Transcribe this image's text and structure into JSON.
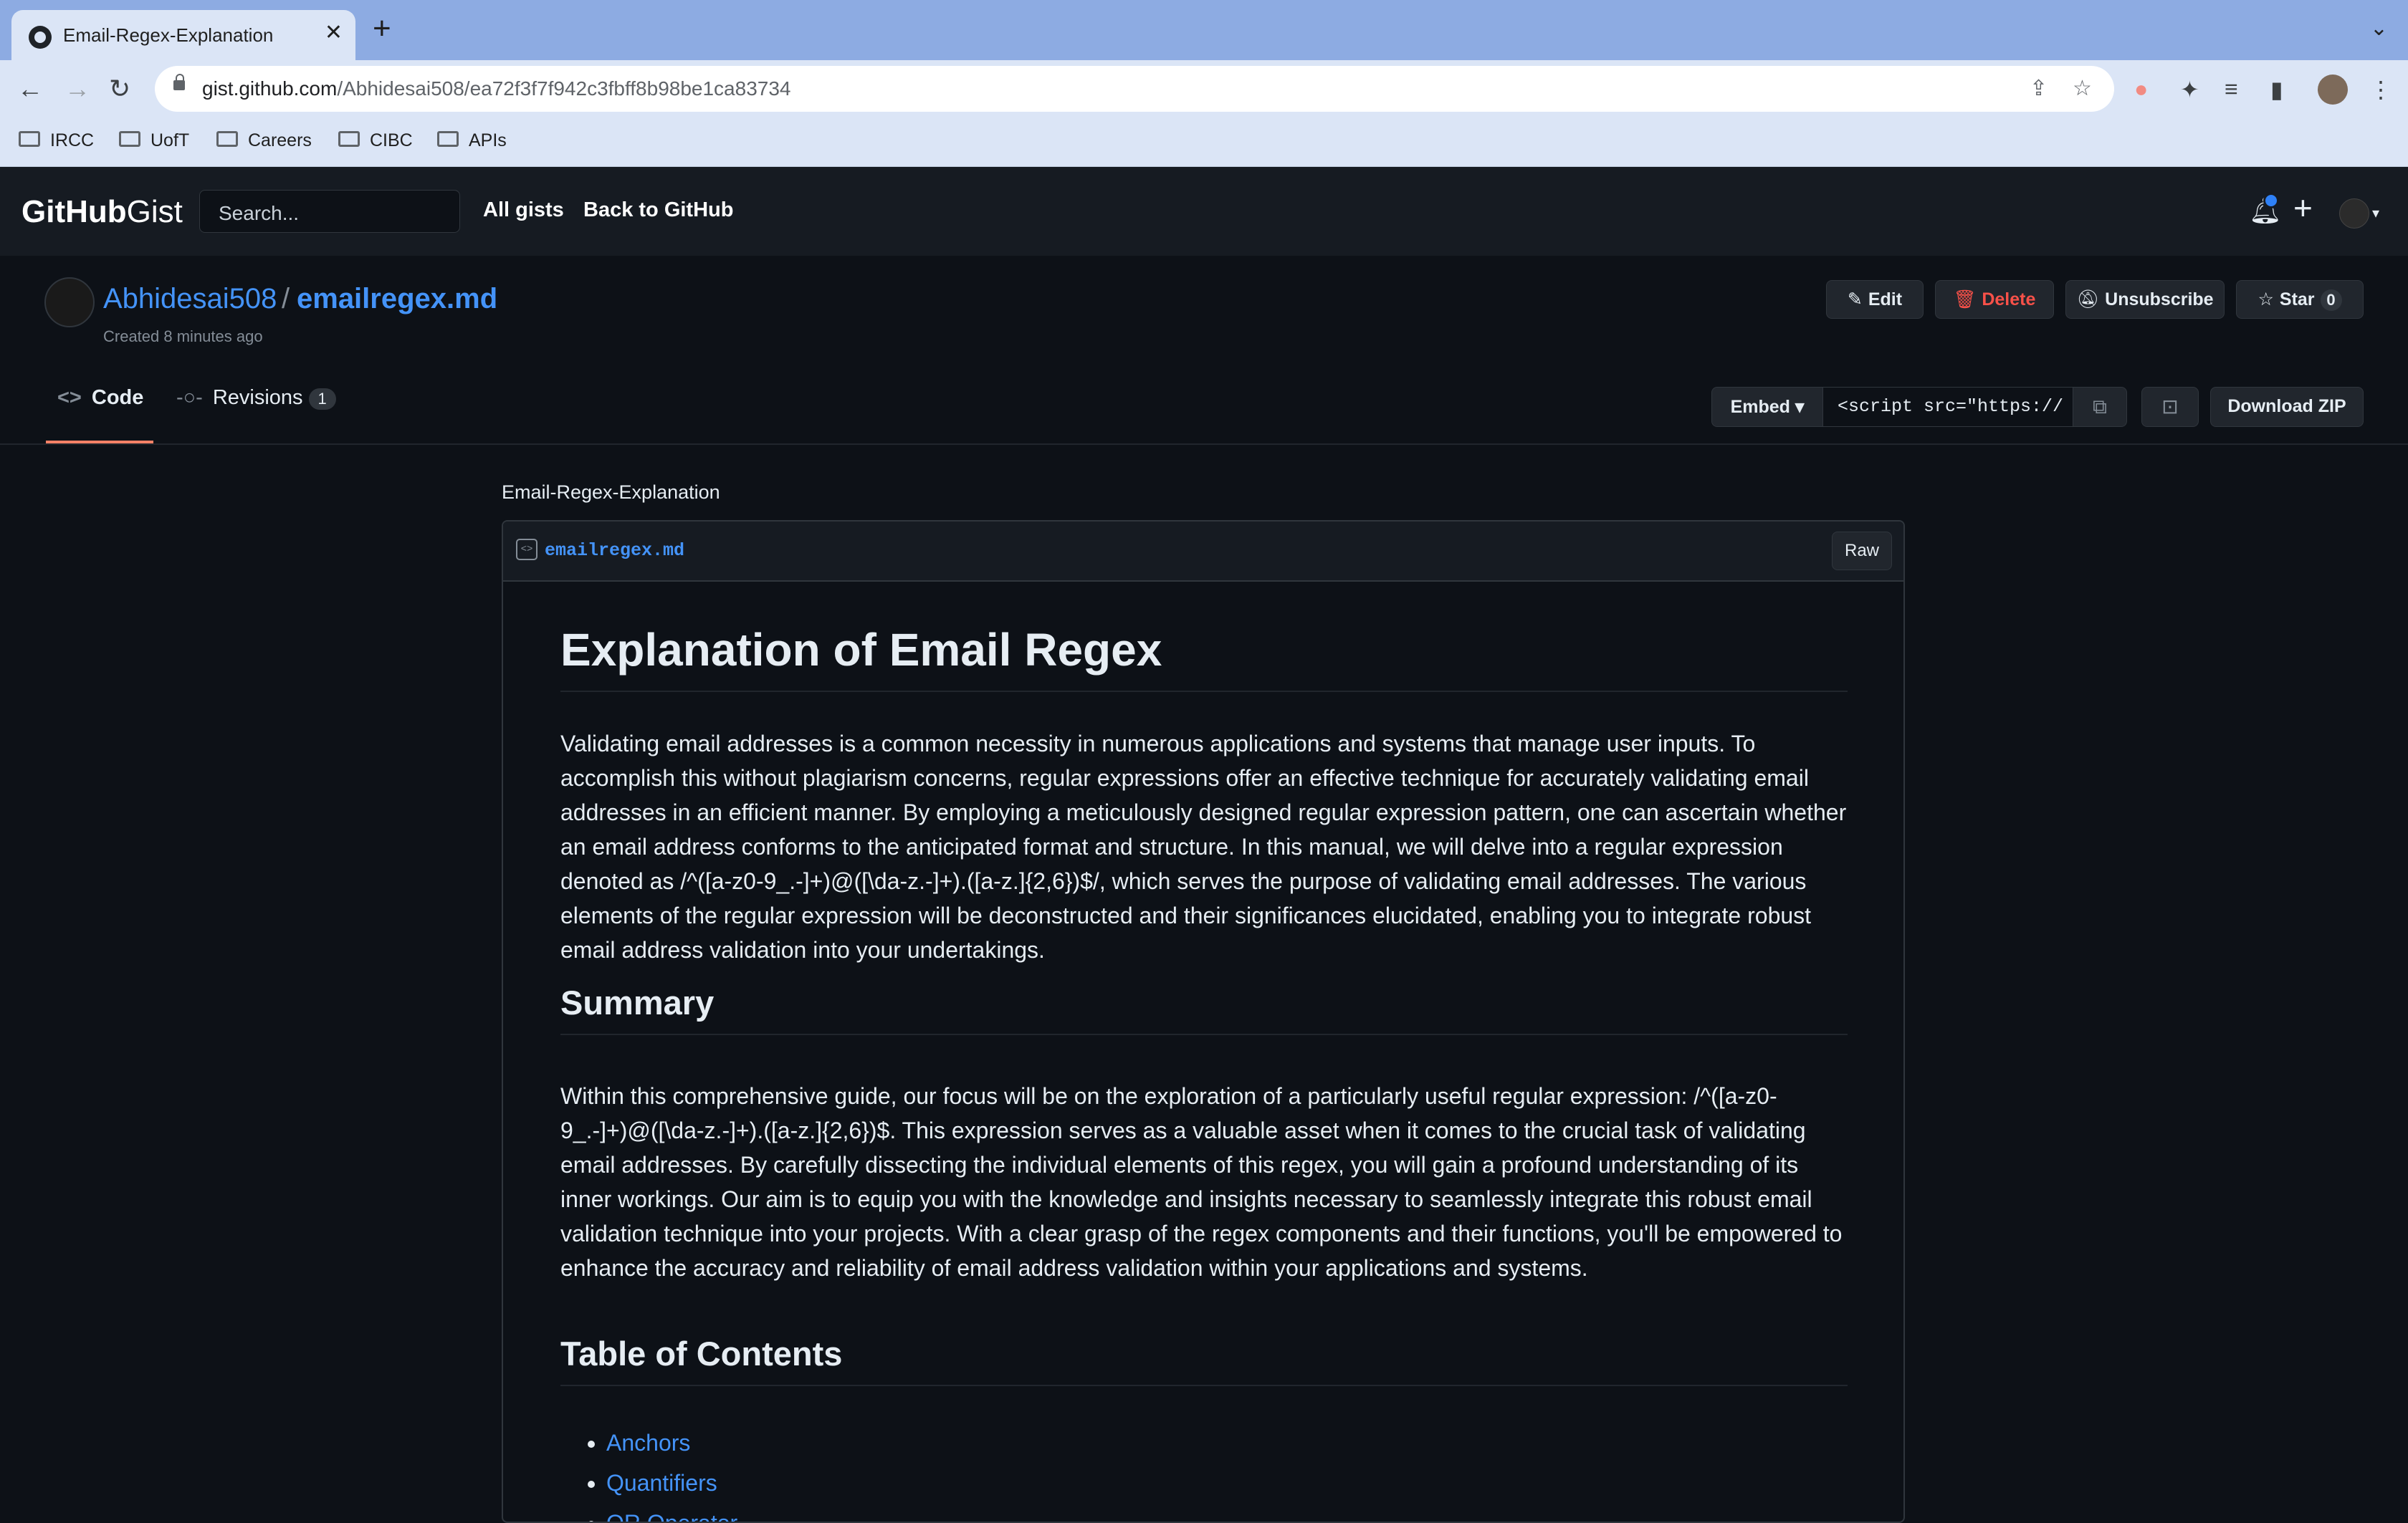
{
  "browser": {
    "tab_title": "Email-Regex-Explanation",
    "tab_close": "✕",
    "new_tab": "+",
    "url_host": "gist.github.com",
    "url_path": "/Abhidesai508/ea72f3f7f942c3fbff8b98be1ca83734",
    "bookmarks": [
      "IRCC",
      "UofT",
      "Careers",
      "CIBC",
      "APIs"
    ]
  },
  "gh_header": {
    "logo_bold": "GitHub",
    "logo_light": "Gist",
    "search_placeholder": "Search...",
    "all_gists": "All gists",
    "back_to_github": "Back to GitHub"
  },
  "gist": {
    "owner": "Abhidesai508",
    "separator": "/",
    "filename": "emailregex.md",
    "created": "Created 8 minutes ago",
    "actions": {
      "edit": "Edit",
      "delete": "Delete",
      "unsubscribe": "Unsubscribe",
      "star": "Star",
      "star_count": "0"
    },
    "tabs": {
      "code": "Code",
      "revisions": "Revisions",
      "revisions_count": "1"
    },
    "embed": {
      "select_label": "Embed",
      "value": "<script src=\"https://"
    },
    "download_zip": "Download ZIP",
    "description": "Email-Regex-Explanation"
  },
  "file": {
    "name": "emailregex.md",
    "raw_label": "Raw",
    "h1": "Explanation of Email Regex",
    "intro": "Validating email addresses is a common necessity in numerous applications and systems that manage user inputs. To accomplish this without plagiarism concerns, regular expressions offer an effective technique for accurately validating email addresses in an efficient manner. By employing a meticulously designed regular expression pattern, one can ascertain whether an email address conforms to the anticipated format and structure. In this manual, we will delve into a regular expression denoted as /^([a-z0-9_.-]+)@([\\da-z.-]+).([a-z.]{2,6})$/, which serves the purpose of validating email addresses. The various elements of the regular expression will be deconstructed and their significances elucidated, enabling you to integrate robust email address validation into your undertakings.",
    "summary_heading": "Summary",
    "summary": "Within this comprehensive guide, our focus will be on the exploration of a particularly useful regular expression: /^([a-z0-9_.-]+)@([\\da-z.-]+).([a-z.]{2,6})$. This expression serves as a valuable asset when it comes to the crucial task of validating email addresses. By carefully dissecting the individual elements of this regex, you will gain a profound understanding of its inner workings. Our aim is to equip you with the knowledge and insights necessary to seamlessly integrate this robust email validation technique into your projects. With a clear grasp of the regex components and their functions, you'll be empowered to enhance the accuracy and reliability of email address validation within your applications and systems.",
    "toc_heading": "Table of Contents",
    "toc": [
      "Anchors",
      "Quantifiers",
      "OR Operator"
    ]
  }
}
